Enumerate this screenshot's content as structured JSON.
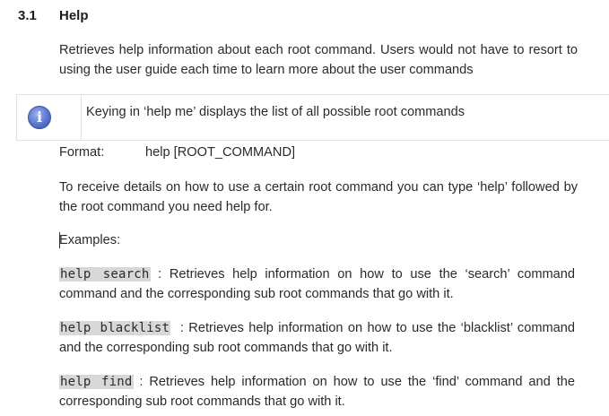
{
  "section": {
    "number": "3.1",
    "title": "Help"
  },
  "intro": "Retrieves help information about each root command. Users would not have to resort to using the user guide each time to learn more about the user commands",
  "note": {
    "icon": "info-icon",
    "text": "Keying in ‘help me’ displays  the list of all possible root commands"
  },
  "format": {
    "label": "Format:",
    "value": "help [ROOT_COMMAND]"
  },
  "details": "To receive details on how to use a certain root command you can type ‘help’ followed by the root command you need help for.",
  "examples_label": "Examples:",
  "examples": [
    {
      "command": "help search",
      "separator": " : ",
      "description": "Retrieves help information on how to use the ‘search’ command command and the corresponding sub root commands that go with it."
    },
    {
      "command": "help blacklist",
      "separator": "  : ",
      "description": "Retrieves help information on how to use the ‘blacklist’ command and the corresponding sub root commands that go with it."
    },
    {
      "command": "help find",
      "separator": " : ",
      "description": "Retrieves help information on how to use the ‘find’  command and the corresponding sub root commands that go with it."
    }
  ]
}
